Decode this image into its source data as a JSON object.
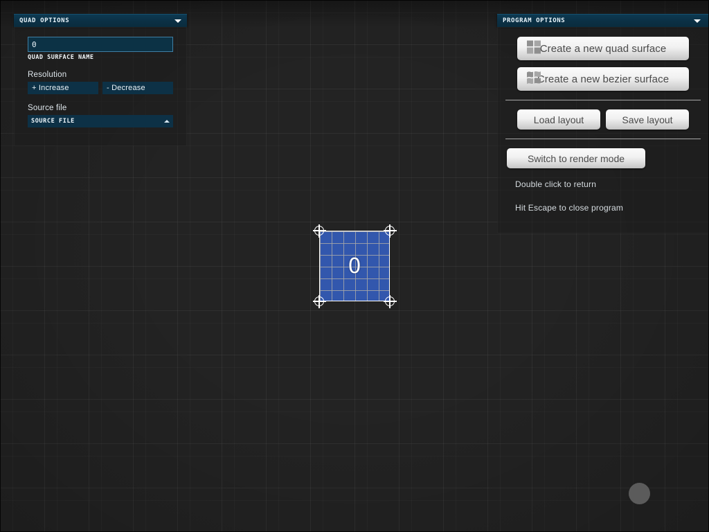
{
  "canvas": {
    "background_color": "#232323",
    "grid_color": "#3a3a3a",
    "cursor_indicator": "cursor-dot"
  },
  "quad_panel": {
    "header_title": "QUAD OPTIONS",
    "collapse_icon": "chevron-down-icon",
    "name_field": {
      "value": "0",
      "placeholder": "0",
      "caption": "QUAD SURFACE NAME"
    },
    "resolution": {
      "label": "Resolution",
      "increase_label": "+ Increase",
      "decrease_label": "- Decrease"
    },
    "source_file": {
      "label": "Source file",
      "selected": "SOURCE FILE",
      "expand_icon": "chevron-up-icon",
      "options": [
        "SOURCE FILE"
      ]
    },
    "accent_color": "#0d3146",
    "border_color": "#3f7fa4"
  },
  "program_panel": {
    "header_title": "PROGRAM OPTIONS",
    "collapse_icon": "chevron-down-icon",
    "create_quad_label": "Create a new quad surface",
    "create_quad_icon": "quad-surface-icon",
    "create_bezier_label": "Create a new bezier surface",
    "create_bezier_icon": "bezier-surface-icon",
    "load_layout_label": "Load layout",
    "save_layout_label": "Save layout",
    "switch_render_label": "Switch to render mode",
    "hint_double_click": "Double click to return",
    "hint_escape": "Hit Escape to close program",
    "button_color": "#f1f1f1",
    "button_text_color": "#4a4a4a"
  },
  "quad_surface": {
    "label": "0",
    "fill_color": "#3257ad",
    "grid_line_color": "#a8a8a8",
    "outline_color": "#ffffff",
    "handle_icon": "crosshair-handle-icon",
    "handles": [
      "top-left",
      "top-right",
      "bottom-left",
      "bottom-right"
    ]
  }
}
